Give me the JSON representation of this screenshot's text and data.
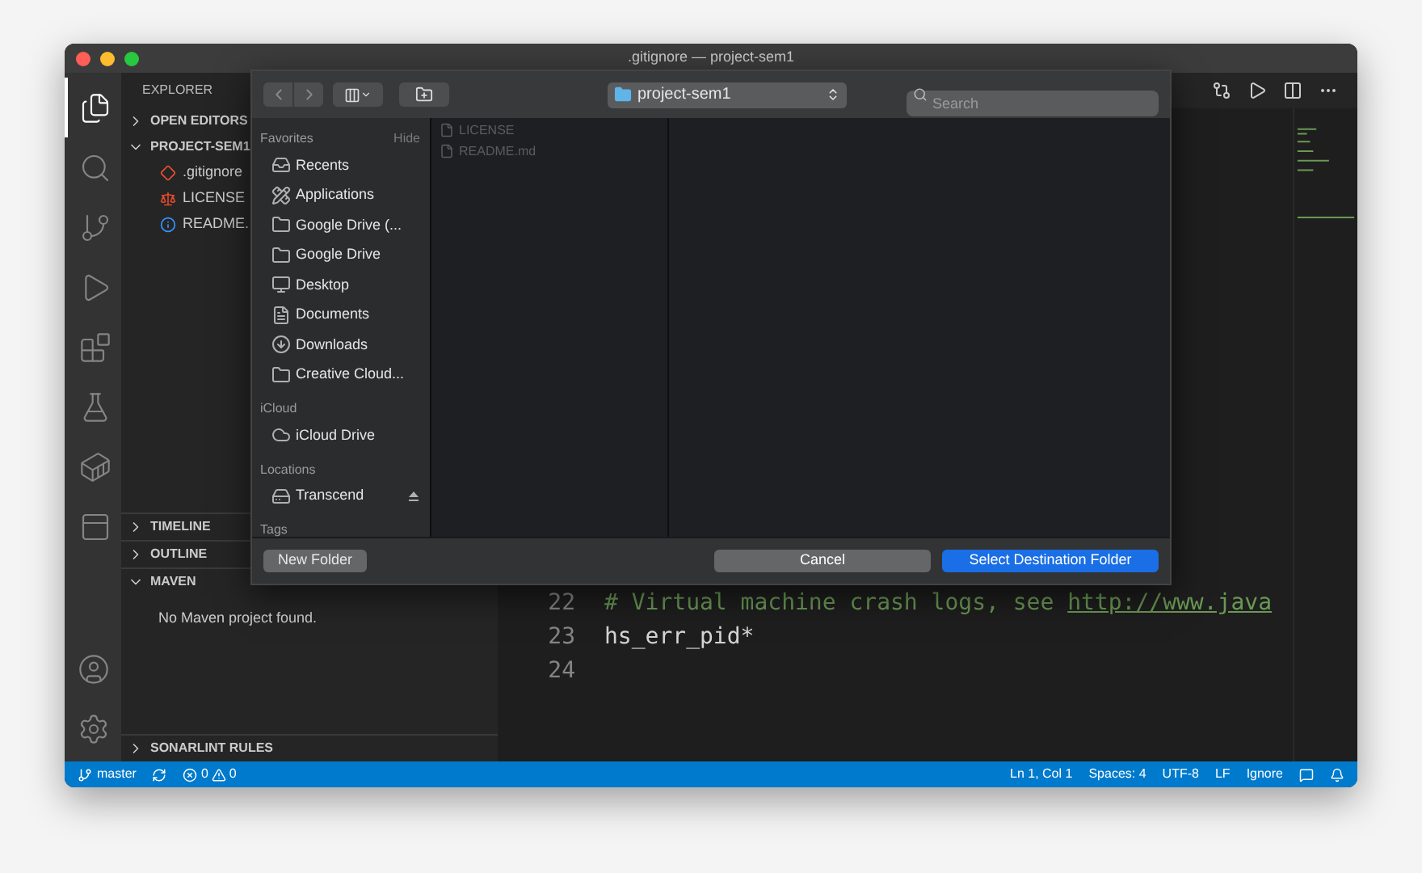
{
  "window": {
    "title": ".gitignore — project-sem1"
  },
  "activity_bar": [
    {
      "kind": "files",
      "selected": true
    },
    {
      "kind": "search",
      "selected": false
    },
    {
      "kind": "source-control",
      "selected": false
    },
    {
      "kind": "run",
      "selected": false
    },
    {
      "kind": "extensions",
      "selected": false
    },
    {
      "kind": "testing",
      "selected": false
    },
    {
      "kind": "docker",
      "selected": false
    },
    {
      "kind": "panel",
      "selected": false
    }
  ],
  "sidebar": {
    "title": "EXPLORER",
    "top_sections": [
      {
        "label": "OPEN EDITORS",
        "expanded": false
      },
      {
        "label": "PROJECT-SEM1",
        "expanded": true,
        "children": [
          {
            "name": ".gitignore",
            "kind": "git"
          },
          {
            "name": "LICENSE",
            "kind": "license"
          },
          {
            "name": "README.",
            "kind": "info"
          }
        ]
      }
    ],
    "lower_sections": [
      {
        "label": "TIMELINE",
        "expanded": false
      },
      {
        "label": "OUTLINE",
        "expanded": false
      },
      {
        "label": "MAVEN",
        "expanded": true,
        "message": "No Maven project found."
      }
    ],
    "bottom_section": {
      "label": "SONARLINT RULES",
      "expanded": false
    }
  },
  "editor": {
    "lines": [
      {
        "number": "22",
        "kind": "comment",
        "text": "# Virtual machine crash logs, see ",
        "link": "http://www.java"
      },
      {
        "number": "23",
        "kind": "plain",
        "text": "hs_err_pid*"
      },
      {
        "number": "24"
      }
    ]
  },
  "dialog": {
    "location": "project-sem1",
    "search": {
      "placeholder": "Search"
    },
    "sidebar": [
      {
        "heading": "Favorites",
        "action": "Hide",
        "items": [
          {
            "label": "Recents",
            "kind": "recents"
          },
          {
            "label": "Applications",
            "kind": "applications"
          },
          {
            "label": "Google Drive (...",
            "kind": "folder"
          },
          {
            "label": "Google Drive",
            "kind": "folder"
          },
          {
            "label": "Desktop",
            "kind": "desktop"
          },
          {
            "label": "Documents",
            "kind": "documents"
          },
          {
            "label": "Downloads",
            "kind": "downloads"
          },
          {
            "label": "Creative Cloud...",
            "kind": "folder"
          }
        ]
      },
      {
        "heading": "iCloud",
        "items": [
          {
            "label": "iCloud Drive",
            "kind": "cloud"
          }
        ]
      },
      {
        "heading": "Locations",
        "items": [
          {
            "label": "Transcend",
            "kind": "drive",
            "ejectable": true
          }
        ]
      },
      {
        "heading": "Tags"
      }
    ],
    "files": [
      {
        "name": "LICENSE",
        "disabled": true
      },
      {
        "name": "README.md",
        "disabled": true
      }
    ],
    "new_folder": "New Folder",
    "buttons": [
      {
        "label": "Cancel",
        "kind": "secondary"
      },
      {
        "label": "Select Destination Folder",
        "kind": "primary"
      }
    ]
  },
  "status_bar": {
    "branch": "master",
    "errors": "0",
    "warnings": "0",
    "right": [
      "Ln 1, Col 1",
      "Spaces: 4",
      "UTF-8",
      "LF",
      "Ignore"
    ]
  }
}
